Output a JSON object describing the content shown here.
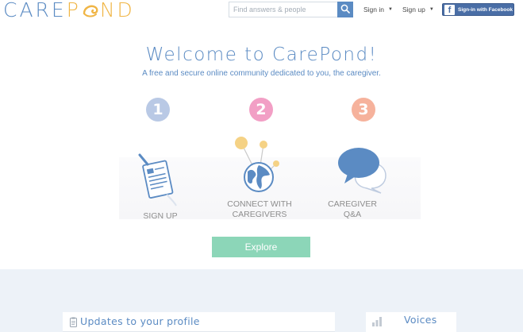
{
  "header": {
    "logo": {
      "part1": "CARE",
      "part2": "P",
      "part3": "ND"
    },
    "search": {
      "placeholder": "Find answers & people"
    },
    "signin_label": "Sign in",
    "signup_label": "Sign up",
    "facebook_label": "Sign-in with Facebook",
    "facebook_icon": "f"
  },
  "hero": {
    "title": "Welcome to CarePond!",
    "subtitle": "A free and secure online community dedicated to you, the caregiver.",
    "steps": [
      {
        "number": "1",
        "label_line1": "SIGN UP",
        "label_line2": "",
        "icon": "signup-document-icon",
        "color": "#b9c9e5"
      },
      {
        "number": "2",
        "label_line1": "CONNECT WITH",
        "label_line2": "CAREGIVERS",
        "icon": "globe-pins-icon",
        "color": "#f29fc5"
      },
      {
        "number": "3",
        "label_line1": "CAREGIVER",
        "label_line2": "Q&A",
        "icon": "speech-bubbles-icon",
        "color": "#f6b29c"
      }
    ],
    "explore_label": "Explore"
  },
  "lower": {
    "updates_title": "Updates to your profile",
    "voices_title": "Voices"
  },
  "colors": {
    "brand_blue": "#5b8bc3",
    "brand_orange": "#f0b545",
    "explore_green": "#8cd6b8",
    "facebook_blue": "#4a6ea6",
    "lower_background": "#edf2f8"
  }
}
